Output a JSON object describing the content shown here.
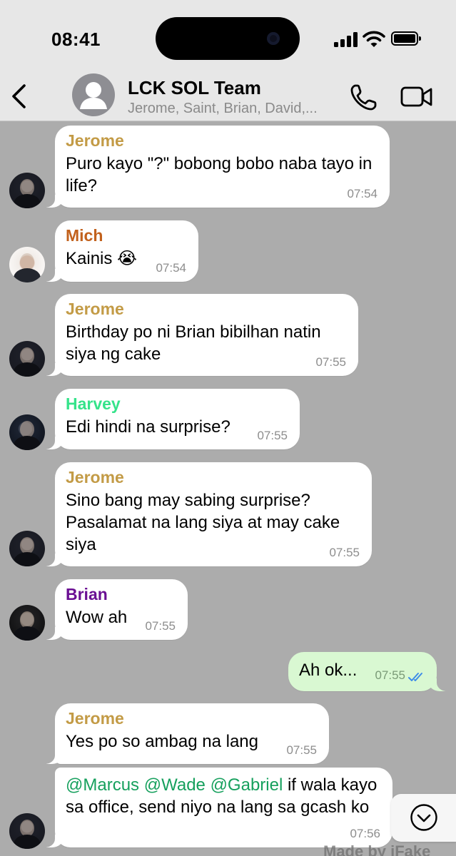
{
  "status_bar": {
    "time": "08:41"
  },
  "header": {
    "title": "LCK SOL Team",
    "subtitle": "Jerome, Saint, Brian, David,..."
  },
  "colors": {
    "background": "#acacac",
    "incoming_bubble": "#ffffff",
    "outgoing_bubble": "#d9f8d2",
    "jerome": "#c39b46",
    "mich": "#c2611c",
    "harvey": "#35e38a",
    "brian": "#6a0f93",
    "mention": "#16a05d",
    "read_ticks": "#3e8ce9"
  },
  "messages": [
    {
      "sender": "Jerome",
      "text": "Puro kayo \"?\" bobong bobo naba tayo in life?",
      "time": "07:54"
    },
    {
      "sender": "Mich",
      "text": "Kainis 😭",
      "time": "07:54"
    },
    {
      "sender": "Jerome",
      "text": "Birthday po ni Brian bibilhan natin siya ng cake",
      "time": "07:55"
    },
    {
      "sender": "Harvey",
      "text": "Edi hindi na surprise?",
      "time": "07:55"
    },
    {
      "sender": "Jerome",
      "text": "Sino bang may sabing surprise? Pasalamat na lang siya at may cake siya",
      "time": "07:55"
    },
    {
      "sender": "Brian",
      "text": "Wow ah",
      "time": "07:55"
    },
    {
      "outgoing": true,
      "text": "Ah ok...",
      "time": "07:55"
    },
    {
      "sender": "Jerome",
      "text": "Yes po so ambag na lang",
      "time": "07:55"
    },
    {
      "mentions": [
        "@Marcus",
        "@Wade",
        "@Gabriel"
      ],
      "text": "if wala kayo sa office, send niyo na lang sa gcash ko",
      "time": "07:56"
    }
  ],
  "watermark": "Made by iFake"
}
